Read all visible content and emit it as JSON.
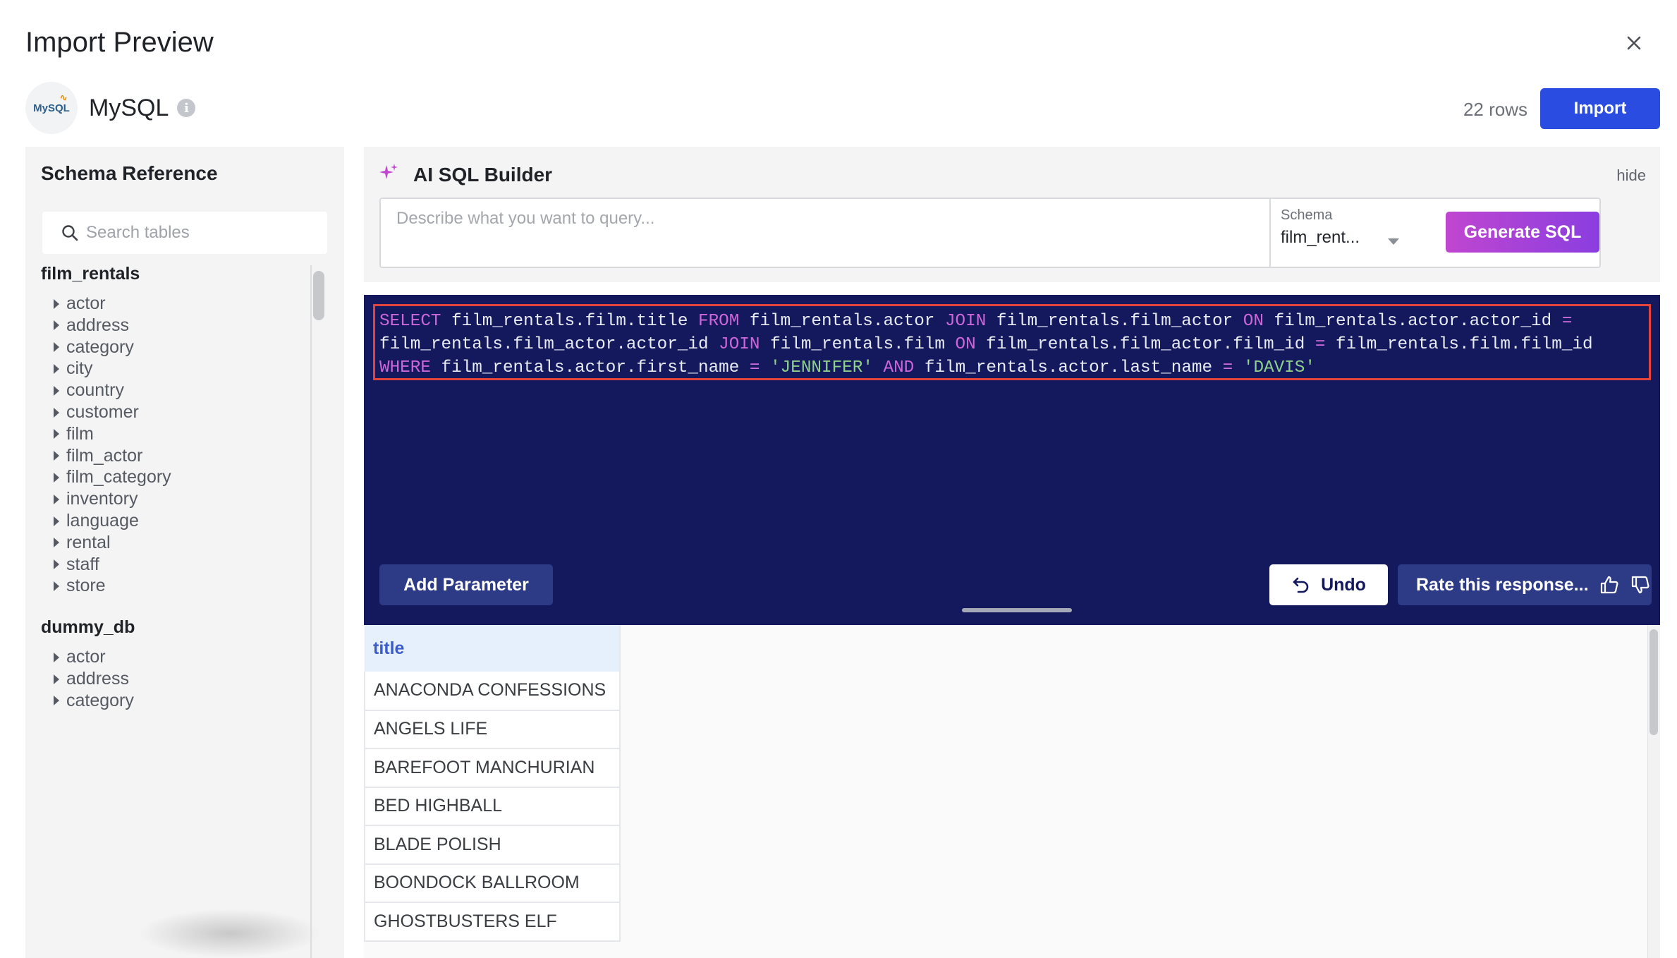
{
  "header": {
    "title": "Import Preview"
  },
  "source": {
    "logo_text": "MySQL",
    "name": "MySQL",
    "info_glyph": "i"
  },
  "toolbar": {
    "row_count": "22 rows",
    "import_label": "Import"
  },
  "sidebar": {
    "title": "Schema Reference",
    "search_placeholder": "Search tables",
    "schemas": [
      {
        "name": "film_rentals",
        "tables": [
          "actor",
          "address",
          "category",
          "city",
          "country",
          "customer",
          "film",
          "film_actor",
          "film_category",
          "inventory",
          "language",
          "rental",
          "staff",
          "store"
        ]
      },
      {
        "name": "dummy_db",
        "tables": [
          "actor",
          "address",
          "category"
        ]
      }
    ]
  },
  "ai_builder": {
    "title": "AI SQL Builder",
    "hide_label": "hide",
    "input_placeholder": "Describe what you want to query...",
    "schema_label": "Schema",
    "schema_value": "film_rent...",
    "generate_label": "Generate SQL"
  },
  "editor": {
    "sql": "SELECT film_rentals.film.title FROM film_rentals.actor JOIN film_rentals.film_actor ON film_rentals.actor.actor_id = film_rentals.film_actor.actor_id JOIN film_rentals.film ON film_rentals.film_actor.film_id = film_rentals.film.film_id WHERE film_rentals.actor.first_name = 'JENNIFER' AND film_rentals.actor.last_name = 'DAVIS'",
    "add_parameter_label": "Add Parameter",
    "undo_label": "Undo",
    "rate_label": "Rate this response..."
  },
  "results": {
    "columns": [
      "title"
    ],
    "rows": [
      "ANACONDA CONFESSIONS",
      "ANGELS LIFE",
      "BAREFOOT MANCHURIAN",
      "BED HIGHBALL",
      "BLADE POLISH",
      "BOONDOCK BALLROOM",
      "GHOSTBUSTERS ELF"
    ]
  },
  "colors": {
    "accent": "#2b4ce0",
    "editor_bg": "#14195e",
    "highlight_border": "#e2433b",
    "generate_gradient_start": "#c046d0",
    "generate_gradient_end": "#8a3ee0"
  },
  "icons": {
    "close": "close-icon",
    "info": "info-icon",
    "search": "search-icon",
    "sparkle": "sparkle-icon",
    "undo": "undo-icon",
    "thumbs_up": "thumbs-up-icon",
    "thumbs_down": "thumbs-down-icon",
    "caret": "caret-right-icon",
    "dropdown": "chevron-down-icon"
  }
}
